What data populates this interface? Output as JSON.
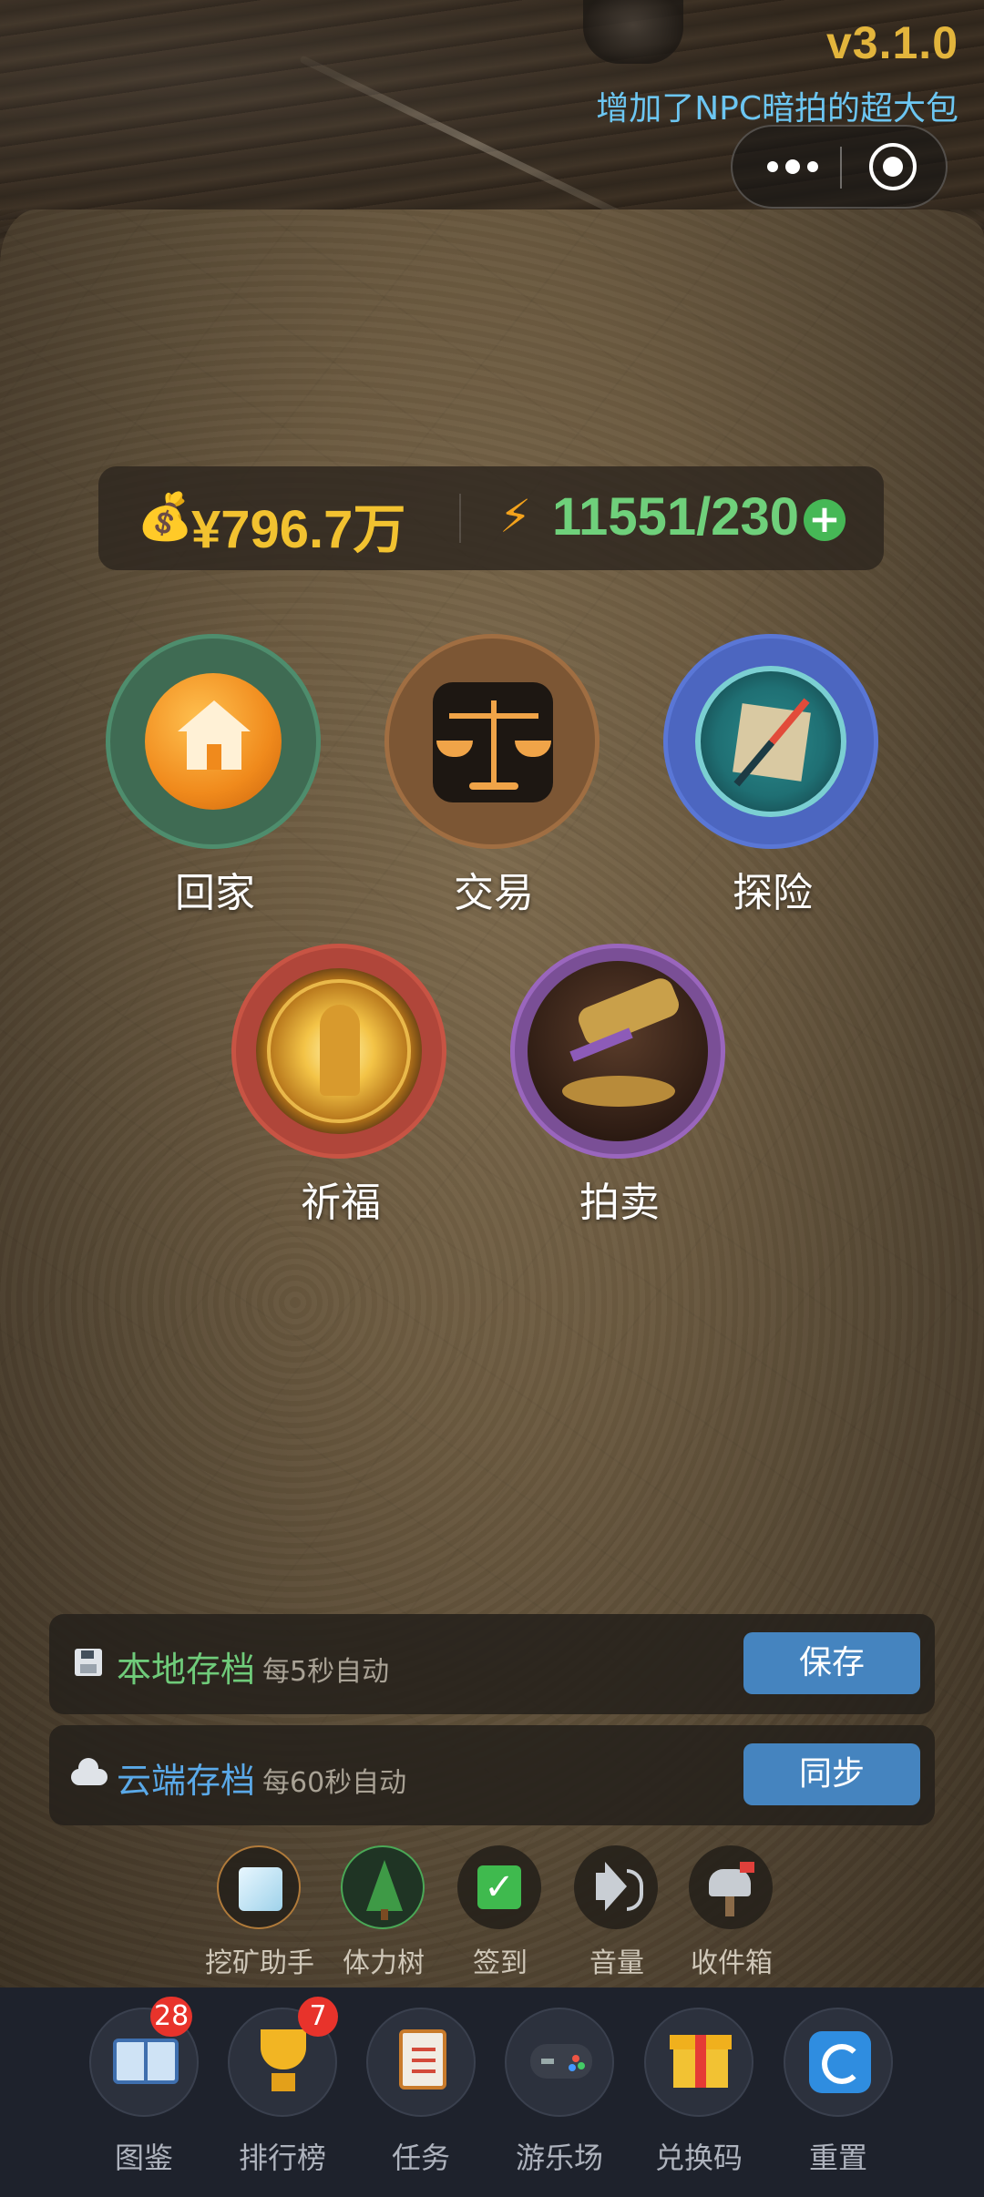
{
  "header": {
    "version": "v3.1.0",
    "announcement": "增加了NPC暗拍的超大包"
  },
  "capsule": {
    "more_icon": "more-dots-icon",
    "close_icon": "target-icon"
  },
  "stats": {
    "money_icon": "money-bag-icon",
    "money": "¥796.7万",
    "energy_icon": "lightning-icon",
    "energy": "11551/230",
    "plus_icon": "plus-icon"
  },
  "menu": [
    {
      "label": "回家",
      "icon": "home-icon"
    },
    {
      "label": "交易",
      "icon": "scale-icon"
    },
    {
      "label": "探险",
      "icon": "compass-icon"
    },
    {
      "label": "祈福",
      "icon": "pray-icon"
    },
    {
      "label": "拍卖",
      "icon": "gavel-icon"
    }
  ],
  "saves": {
    "local": {
      "title": "本地存档",
      "hint": "每5秒自动",
      "button": "保存",
      "icon": "floppy-icon",
      "color": "#6fcb7a"
    },
    "cloud": {
      "title": "云端存档",
      "hint": "每60秒自动",
      "button": "同步",
      "icon": "cloud-icon",
      "color": "#5aa9e8"
    }
  },
  "tools": [
    {
      "label": "挖矿助手",
      "icon": "ice-cube-icon"
    },
    {
      "label": "体力树",
      "icon": "tree-icon"
    },
    {
      "label": "签到",
      "icon": "checkmark-icon"
    },
    {
      "label": "音量",
      "icon": "speaker-icon"
    },
    {
      "label": "收件箱",
      "icon": "mailbox-icon"
    }
  ],
  "nav": [
    {
      "label": "图鉴",
      "badge": "28",
      "icon": "book-icon"
    },
    {
      "label": "排行榜",
      "badge": "7",
      "icon": "trophy-icon"
    },
    {
      "label": "任务",
      "badge": null,
      "icon": "clipboard-icon"
    },
    {
      "label": "游乐场",
      "badge": null,
      "icon": "gamepad-icon"
    },
    {
      "label": "兑换码",
      "badge": null,
      "icon": "gift-icon"
    },
    {
      "label": "重置",
      "badge": null,
      "icon": "reload-icon"
    }
  ]
}
